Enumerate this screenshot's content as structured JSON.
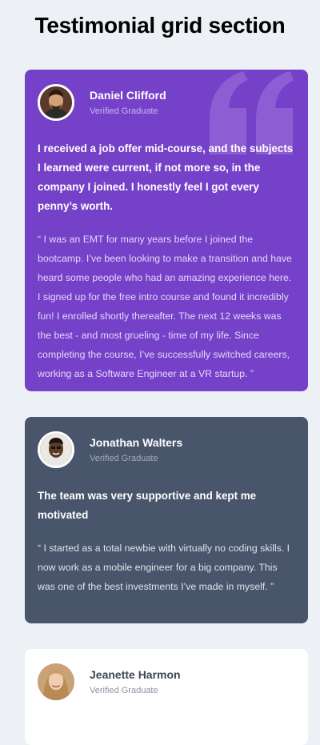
{
  "page": {
    "title": "Testimonial grid section"
  },
  "colors": {
    "page_background": "#edf0f5",
    "card_purple": "#7541c8",
    "card_slate": "#48556a",
    "card_white": "#ffffff"
  },
  "testimonials": [
    {
      "name": "Daniel Clifford",
      "role": "Verified Graduate",
      "headline": "I received a job offer mid-course, and the subjects I learned were current, if not more so, in the company I joined. I honestly feel I got every penny’s worth.",
      "body": "“ I was an EMT for many years before I joined the bootcamp. I’ve been looking to make a transition and have heard some people who had an amazing experience here. I signed up for the free intro course and found it incredibly fun! I enrolled shortly thereafter. The next 12 weeks was the best - and most grueling - time of my life. Since completing the course, I’ve successfully switched careers, working as a Software Engineer at a VR startup. ”",
      "theme": "purple",
      "icon": "quotation-icon"
    },
    {
      "name": "Jonathan Walters",
      "role": "Verified Graduate",
      "headline": "The team was very supportive and kept me motivated",
      "body": "“ I started as a total newbie with virtually no coding skills. I now work as a mobile engineer for a big company. This was one of the best investments I’ve made in myself. ”",
      "theme": "slate"
    },
    {
      "name": "Jeanette Harmon",
      "role": "Verified Graduate",
      "theme": "white"
    }
  ]
}
